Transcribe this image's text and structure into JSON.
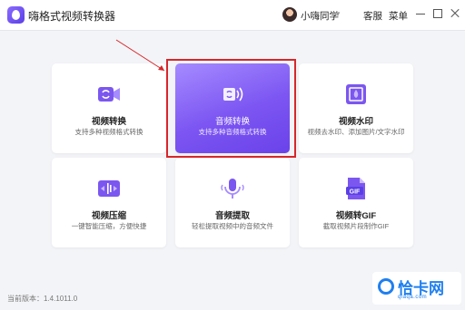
{
  "app": {
    "title": "嗨格式视频转换器"
  },
  "header": {
    "user_name": "小嗨同学",
    "support": "客服",
    "menu": "菜单"
  },
  "cards": [
    {
      "title": "视频转换",
      "desc": "支持多种视频格式转换",
      "icon": "video-convert-icon"
    },
    {
      "title": "音频转换",
      "desc": "支持多种音频格式转换",
      "icon": "audio-convert-icon",
      "active": true
    },
    {
      "title": "视频水印",
      "desc": "视频去水印、添加图片/文字水印",
      "icon": "video-watermark-icon"
    },
    {
      "title": "视频压缩",
      "desc": "一键智能压缩，方便快捷",
      "icon": "video-compress-icon"
    },
    {
      "title": "音频提取",
      "desc": "轻松提取视频中的音频文件",
      "icon": "microphone-icon"
    },
    {
      "title": "视频转GIF",
      "desc": "截取视频片段制作GIF",
      "icon": "gif-file-icon",
      "badge": "GIF"
    }
  ],
  "footer": {
    "version": "当前版本：1.4.1011.0"
  },
  "watermark": {
    "text": "恰卡网",
    "sub": "qiaqa.com"
  },
  "colors": {
    "accent": "#7c55f2",
    "highlight": "#d7262a",
    "watermark": "#1f7ff0"
  }
}
